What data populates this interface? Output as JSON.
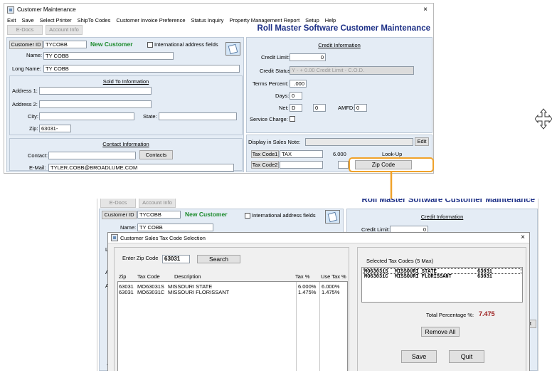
{
  "top_window": {
    "title": "Customer Maintenance",
    "close": "×",
    "menu": [
      "Exit",
      "Save",
      "Select Printer",
      "ShipTo Codes",
      "Customer Invoice Preference",
      "Status Inquiry",
      "Property Management Report",
      "Setup",
      "Help"
    ],
    "tabs": [
      "E-Docs",
      "Account Info"
    ],
    "app_title": "Roll Master Software Customer Maintenance",
    "customer_id_label": "Customer ID",
    "customer_id": "TYCOBB",
    "new_customer": "New Customer",
    "intl_label": "International address fields",
    "name_label": "Name:",
    "name": "TY COBB",
    "long_name_label": "Long Name:",
    "long_name": "TY COBB",
    "sold_to_header": "Sold To Information",
    "address1_label": "Address 1:",
    "address2_label": "Address 2:",
    "city_label": "City:",
    "state_label": "State:",
    "zip_label": "Zip:",
    "zip": "63031-",
    "contact_header": "Contact Information",
    "contact_label": "Contact:",
    "contacts_button": "Contacts",
    "email_label": "E-Mail:",
    "email": "TYLER.COBB@BROADLUME.COM",
    "credit_header": "Credit Information",
    "credit_limit_label": "Credit Limit:",
    "credit_limit": "0",
    "credit_status_label": "Credit Status:",
    "credit_status": "Y - + 0.00 Credit Limit - C.O.D.",
    "terms_percent_label": "Terms Percent:",
    "terms_percent": ".000",
    "days_label": "Days:",
    "days": "0",
    "net_label": "Net:",
    "net": "D",
    "net2": "0",
    "amfd_label": "AMFD:",
    "amfd": "0",
    "service_charge_label": "Service Charge:",
    "display_note_label": "Display in Sales Note:",
    "edit_button": "Edit",
    "tax_code1_label": "Tax Code1",
    "tax_code1": "TAX",
    "tax_code1_rate": "6.000",
    "tax_code2_label": "Tax Code2",
    "lookup_label": "Look-Up",
    "zip_code_button": "Zip Code"
  },
  "bottom_window": {
    "tabs": [
      "E-Docs",
      "Account Info"
    ],
    "app_title": "Roll Master Software Customer Maintenance",
    "customer_id_label": "Customer ID",
    "customer_id": "TYCOBB",
    "new_customer": "New Customer",
    "intl_label": "International address fields",
    "name_label": "Name:",
    "name": "TY COBB",
    "credit_header": "Credit Information",
    "credit_limit_label": "Credit Limit:",
    "credit_limit": "0",
    "edge_edit": "dit",
    "edge_l": "L",
    "edge_ac": "Ac",
    "edge_t": "T"
  },
  "dialog": {
    "title": "Customer Sales Tax Code Selection",
    "close": "×",
    "enter_zip_label": "Enter Zip Code",
    "zip_value": "63031",
    "search_button": "Search",
    "columns": [
      "Zip",
      "Tax Code",
      "Description",
      "Tax %",
      "Use Tax %"
    ],
    "rows": [
      {
        "zip": "63031",
        "code": "MO63031S",
        "desc": "MISSOURI STATE",
        "tax": "6.000%",
        "use": "6.000%"
      },
      {
        "zip": "63031",
        "code": "MO63031C",
        "desc": "MISSOURI FLORISSANT",
        "tax": "1.475%",
        "use": "1.475%"
      }
    ],
    "selected_header": "Selected Tax Codes (5 Max)",
    "selected": [
      {
        "code": "MO63031S",
        "desc": "MISSOURI STATE",
        "zip": "63031"
      },
      {
        "code": "MO63031C",
        "desc": "MISSOURI FLORISSANT",
        "zip": "63031"
      }
    ],
    "total_label": "Total Percentage %:",
    "total_value": "7.475",
    "remove_all": "Remove All",
    "save": "Save",
    "quit": "Quit"
  },
  "colors": {
    "callout": "#f0a22a",
    "title_blue": "#1c2f86",
    "new_customer_green": "#1a8a2a",
    "total_red": "#9b1c1c"
  },
  "icons": [
    "move-cursor-icon",
    "notepad-icon",
    "window-app-icon"
  ]
}
